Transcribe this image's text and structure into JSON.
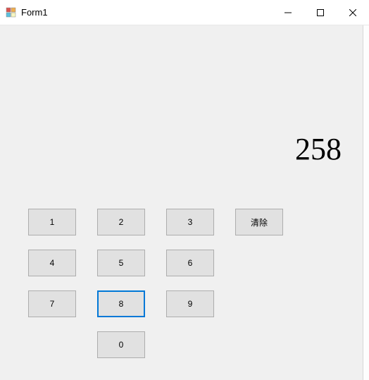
{
  "window": {
    "title": "Form1"
  },
  "display": {
    "value": "258"
  },
  "keypad": {
    "rows": [
      {
        "k1": "1",
        "k2": "2",
        "k3": "3",
        "clear": "清除"
      },
      {
        "k4": "4",
        "k5": "5",
        "k6": "6"
      },
      {
        "k7": "7",
        "k8": "8",
        "k9": "9"
      },
      {
        "k0": "0"
      }
    ],
    "focused_key": "8"
  }
}
